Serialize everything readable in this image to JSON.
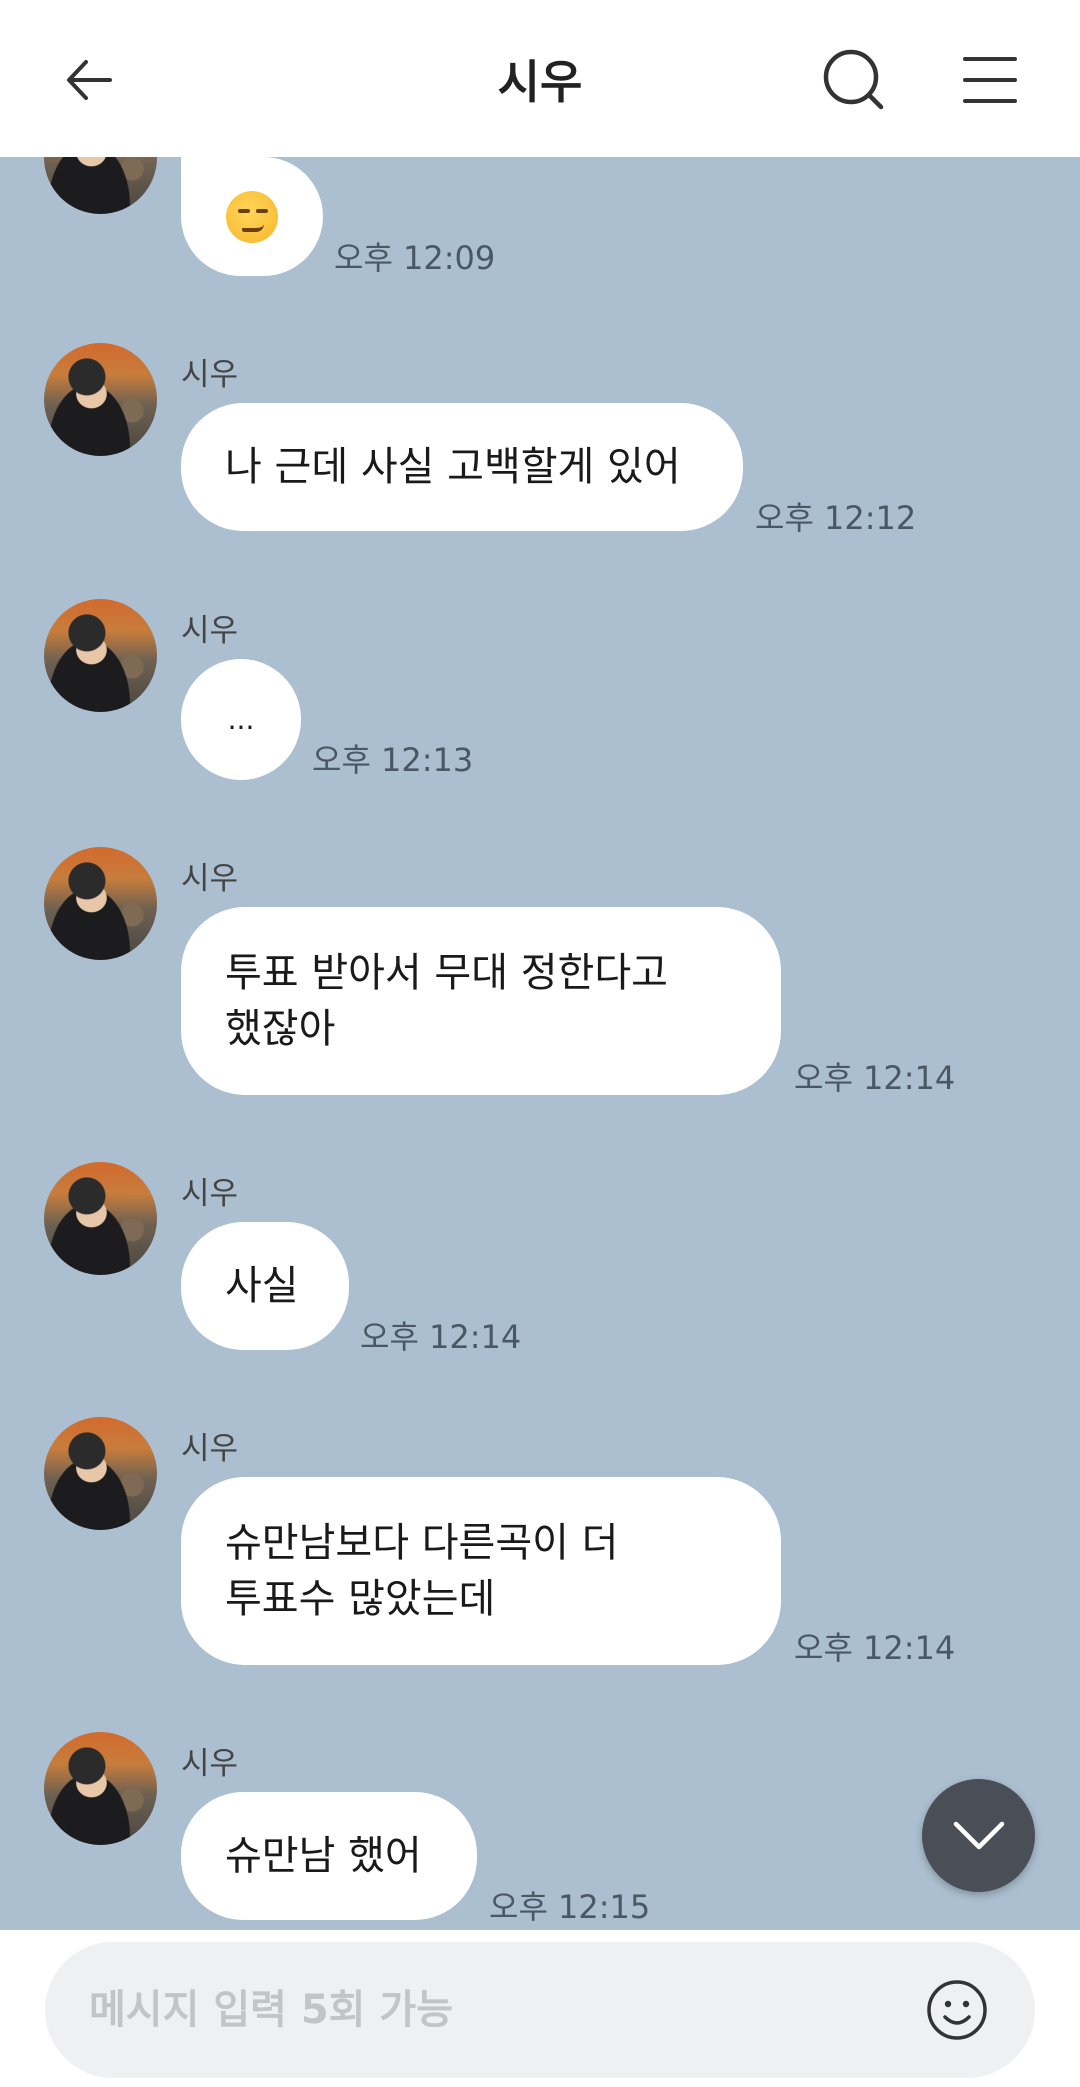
{
  "header": {
    "title": "시우"
  },
  "messages": [
    {
      "sender": "",
      "type": "emoji",
      "emoji": "smirking-face-icon",
      "time": "오후 12:09"
    },
    {
      "sender": "시우",
      "lines": [
        "나 근데 사실 고백할게 있어"
      ],
      "time": "오후 12:12"
    },
    {
      "sender": "시우",
      "lines": [
        "..."
      ],
      "time": "오후 12:13"
    },
    {
      "sender": "시우",
      "lines": [
        "투표 받아서 무대 정한다고",
        "했잖아"
      ],
      "time": "오후 12:14"
    },
    {
      "sender": "시우",
      "lines": [
        "사실"
      ],
      "time": "오후 12:14"
    },
    {
      "sender": "시우",
      "lines": [
        "슈만남보다 다른곡이 더",
        "투표수 많았는데"
      ],
      "time": "오후 12:14"
    },
    {
      "sender": "시우",
      "lines": [
        "슈만남 했어"
      ],
      "time": "오후 12:15"
    }
  ],
  "composer": {
    "placeholder": "메시지 입력 5회 가능"
  },
  "colors": {
    "chat_background": "#abbfd0",
    "bubble": "#ffffff",
    "scroll_button": "#4a4e57"
  }
}
